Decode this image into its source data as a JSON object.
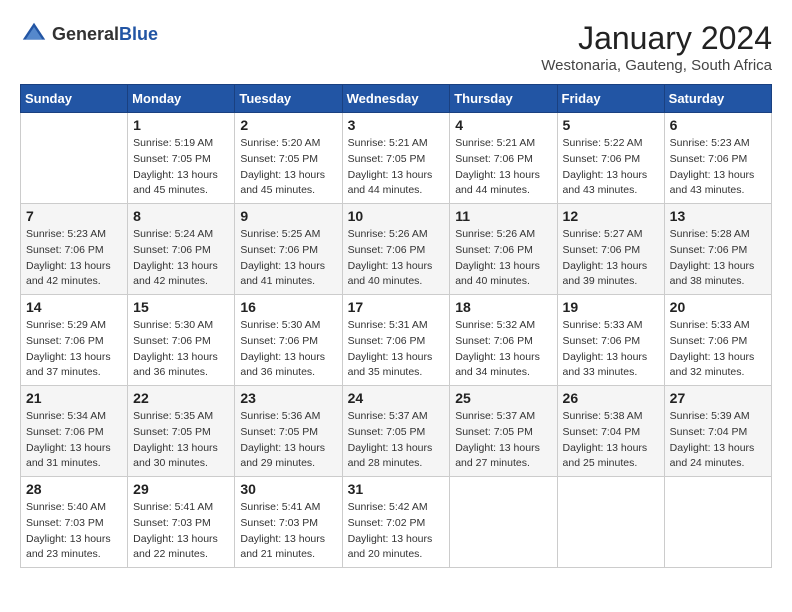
{
  "logo": {
    "general": "General",
    "blue": "Blue"
  },
  "title": "January 2024",
  "location": "Westonaria, Gauteng, South Africa",
  "weekdays": [
    "Sunday",
    "Monday",
    "Tuesday",
    "Wednesday",
    "Thursday",
    "Friday",
    "Saturday"
  ],
  "weeks": [
    [
      {
        "day": "",
        "info": ""
      },
      {
        "day": "1",
        "info": "Sunrise: 5:19 AM\nSunset: 7:05 PM\nDaylight: 13 hours\nand 45 minutes."
      },
      {
        "day": "2",
        "info": "Sunrise: 5:20 AM\nSunset: 7:05 PM\nDaylight: 13 hours\nand 45 minutes."
      },
      {
        "day": "3",
        "info": "Sunrise: 5:21 AM\nSunset: 7:05 PM\nDaylight: 13 hours\nand 44 minutes."
      },
      {
        "day": "4",
        "info": "Sunrise: 5:21 AM\nSunset: 7:06 PM\nDaylight: 13 hours\nand 44 minutes."
      },
      {
        "day": "5",
        "info": "Sunrise: 5:22 AM\nSunset: 7:06 PM\nDaylight: 13 hours\nand 43 minutes."
      },
      {
        "day": "6",
        "info": "Sunrise: 5:23 AM\nSunset: 7:06 PM\nDaylight: 13 hours\nand 43 minutes."
      }
    ],
    [
      {
        "day": "7",
        "info": "Sunrise: 5:23 AM\nSunset: 7:06 PM\nDaylight: 13 hours\nand 42 minutes."
      },
      {
        "day": "8",
        "info": "Sunrise: 5:24 AM\nSunset: 7:06 PM\nDaylight: 13 hours\nand 42 minutes."
      },
      {
        "day": "9",
        "info": "Sunrise: 5:25 AM\nSunset: 7:06 PM\nDaylight: 13 hours\nand 41 minutes."
      },
      {
        "day": "10",
        "info": "Sunrise: 5:26 AM\nSunset: 7:06 PM\nDaylight: 13 hours\nand 40 minutes."
      },
      {
        "day": "11",
        "info": "Sunrise: 5:26 AM\nSunset: 7:06 PM\nDaylight: 13 hours\nand 40 minutes."
      },
      {
        "day": "12",
        "info": "Sunrise: 5:27 AM\nSunset: 7:06 PM\nDaylight: 13 hours\nand 39 minutes."
      },
      {
        "day": "13",
        "info": "Sunrise: 5:28 AM\nSunset: 7:06 PM\nDaylight: 13 hours\nand 38 minutes."
      }
    ],
    [
      {
        "day": "14",
        "info": "Sunrise: 5:29 AM\nSunset: 7:06 PM\nDaylight: 13 hours\nand 37 minutes."
      },
      {
        "day": "15",
        "info": "Sunrise: 5:30 AM\nSunset: 7:06 PM\nDaylight: 13 hours\nand 36 minutes."
      },
      {
        "day": "16",
        "info": "Sunrise: 5:30 AM\nSunset: 7:06 PM\nDaylight: 13 hours\nand 36 minutes."
      },
      {
        "day": "17",
        "info": "Sunrise: 5:31 AM\nSunset: 7:06 PM\nDaylight: 13 hours\nand 35 minutes."
      },
      {
        "day": "18",
        "info": "Sunrise: 5:32 AM\nSunset: 7:06 PM\nDaylight: 13 hours\nand 34 minutes."
      },
      {
        "day": "19",
        "info": "Sunrise: 5:33 AM\nSunset: 7:06 PM\nDaylight: 13 hours\nand 33 minutes."
      },
      {
        "day": "20",
        "info": "Sunrise: 5:33 AM\nSunset: 7:06 PM\nDaylight: 13 hours\nand 32 minutes."
      }
    ],
    [
      {
        "day": "21",
        "info": "Sunrise: 5:34 AM\nSunset: 7:06 PM\nDaylight: 13 hours\nand 31 minutes."
      },
      {
        "day": "22",
        "info": "Sunrise: 5:35 AM\nSunset: 7:05 PM\nDaylight: 13 hours\nand 30 minutes."
      },
      {
        "day": "23",
        "info": "Sunrise: 5:36 AM\nSunset: 7:05 PM\nDaylight: 13 hours\nand 29 minutes."
      },
      {
        "day": "24",
        "info": "Sunrise: 5:37 AM\nSunset: 7:05 PM\nDaylight: 13 hours\nand 28 minutes."
      },
      {
        "day": "25",
        "info": "Sunrise: 5:37 AM\nSunset: 7:05 PM\nDaylight: 13 hours\nand 27 minutes."
      },
      {
        "day": "26",
        "info": "Sunrise: 5:38 AM\nSunset: 7:04 PM\nDaylight: 13 hours\nand 25 minutes."
      },
      {
        "day": "27",
        "info": "Sunrise: 5:39 AM\nSunset: 7:04 PM\nDaylight: 13 hours\nand 24 minutes."
      }
    ],
    [
      {
        "day": "28",
        "info": "Sunrise: 5:40 AM\nSunset: 7:03 PM\nDaylight: 13 hours\nand 23 minutes."
      },
      {
        "day": "29",
        "info": "Sunrise: 5:41 AM\nSunset: 7:03 PM\nDaylight: 13 hours\nand 22 minutes."
      },
      {
        "day": "30",
        "info": "Sunrise: 5:41 AM\nSunset: 7:03 PM\nDaylight: 13 hours\nand 21 minutes."
      },
      {
        "day": "31",
        "info": "Sunrise: 5:42 AM\nSunset: 7:02 PM\nDaylight: 13 hours\nand 20 minutes."
      },
      {
        "day": "",
        "info": ""
      },
      {
        "day": "",
        "info": ""
      },
      {
        "day": "",
        "info": ""
      }
    ]
  ]
}
